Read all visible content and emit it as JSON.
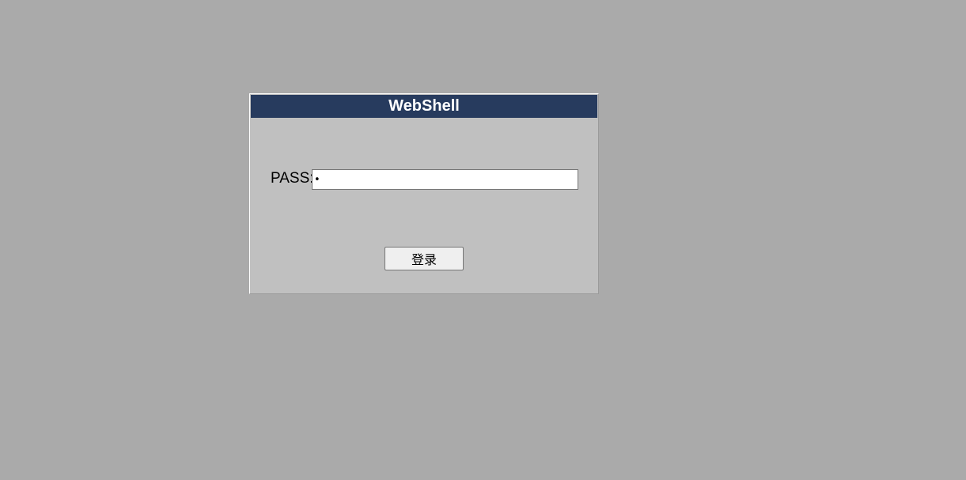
{
  "login": {
    "title": "WebShell",
    "pass_label": "PASS:",
    "pass_value": "x",
    "submit_label": "登录"
  }
}
